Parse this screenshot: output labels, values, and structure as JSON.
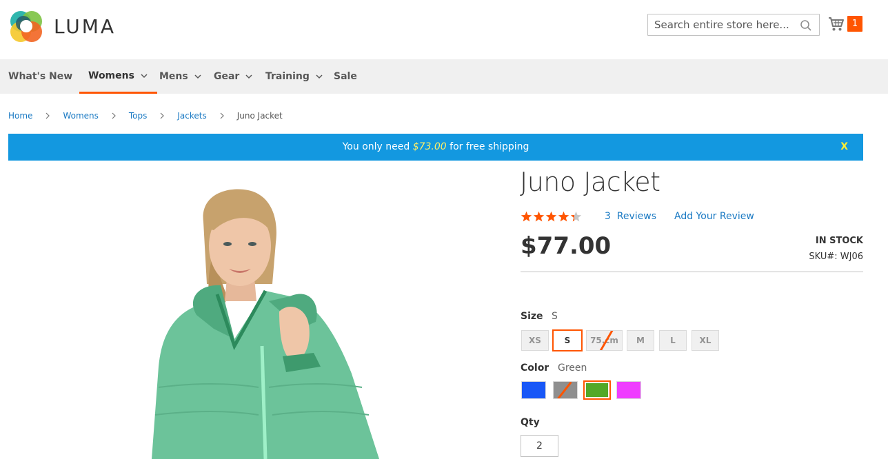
{
  "header": {
    "logo_text": "LUMA",
    "search_placeholder": "Search entire store here...",
    "cart_count": "1"
  },
  "nav": {
    "items": [
      {
        "label": "What's New",
        "has_chevron": false,
        "active": false
      },
      {
        "label": "Womens",
        "has_chevron": true,
        "active": true
      },
      {
        "label": "Mens",
        "has_chevron": true,
        "active": false
      },
      {
        "label": "Gear",
        "has_chevron": true,
        "active": false
      },
      {
        "label": "Training",
        "has_chevron": true,
        "active": false
      },
      {
        "label": "Sale",
        "has_chevron": false,
        "active": false
      }
    ]
  },
  "breadcrumbs": [
    "Home",
    "Womens",
    "Tops",
    "Jackets",
    "Juno Jacket"
  ],
  "banner": {
    "prefix": "You only need",
    "amount": "$73.00",
    "suffix": "for free shipping",
    "close": "X"
  },
  "product": {
    "title": "Juno Jacket",
    "rating_fraction": 0.87,
    "reviews": "3  Reviews",
    "add_review": "Add Your Review",
    "price": "$77.00",
    "stock": "IN STOCK",
    "sku_label": "SKU#:",
    "sku": "WJ06",
    "size_label": "Size",
    "size_value": "S",
    "sizes": [
      "XS",
      "S",
      "75.cm",
      "M",
      "L",
      "XL"
    ],
    "selected_size": "S",
    "disabled_size": "75.cm",
    "color_label": "Color",
    "color_value": "Green",
    "colors": [
      {
        "name": "Blue",
        "hex": "#1857f7"
      },
      {
        "name": "Gray",
        "hex": "#8f8f8f"
      },
      {
        "name": "Green",
        "hex": "#53a828"
      },
      {
        "name": "Purple",
        "hex": "#ef3dff"
      }
    ],
    "qty_label": "Qty",
    "qty_value": "2"
  },
  "colors": {
    "accent": "#ff5501",
    "link": "#1979c3",
    "banner": "#1398e0",
    "nav_bg": "#f0f0f0"
  }
}
